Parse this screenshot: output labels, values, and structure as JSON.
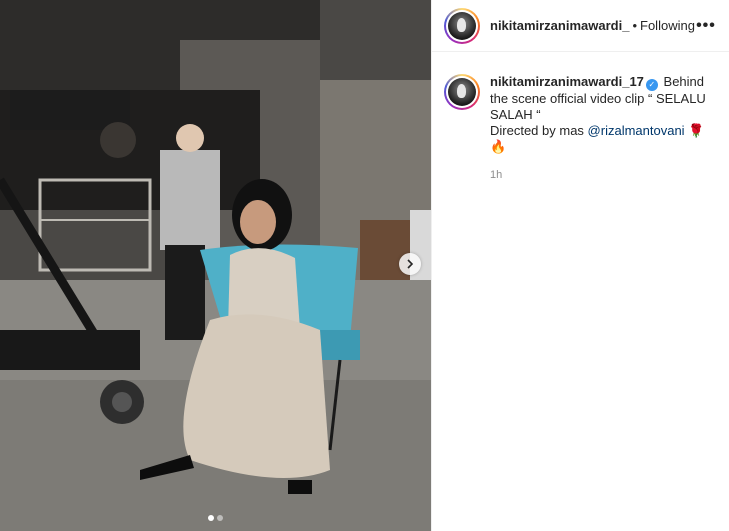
{
  "post": {
    "username": "nikitamirzanimawardi_",
    "separator": "•",
    "follow_status": "Following",
    "more_label": "•••"
  },
  "caption": {
    "username": "nikitamirzanimawardi_17",
    "text_before": "Behind the scene official video clip “ SELALU SALAH “",
    "directed_by": "Directed by mas ",
    "mention": "@rizalmantovani",
    "emoji_rose": "🌹",
    "emoji_fire": "🔥",
    "time": "1h"
  },
  "media": {
    "next_icon": "chevron-right-icon",
    "carousel_count": 2,
    "carousel_active": 1
  },
  "colors": {
    "mention": "#00376b",
    "verified": "#3897f0",
    "muted": "#8e8e8e"
  }
}
